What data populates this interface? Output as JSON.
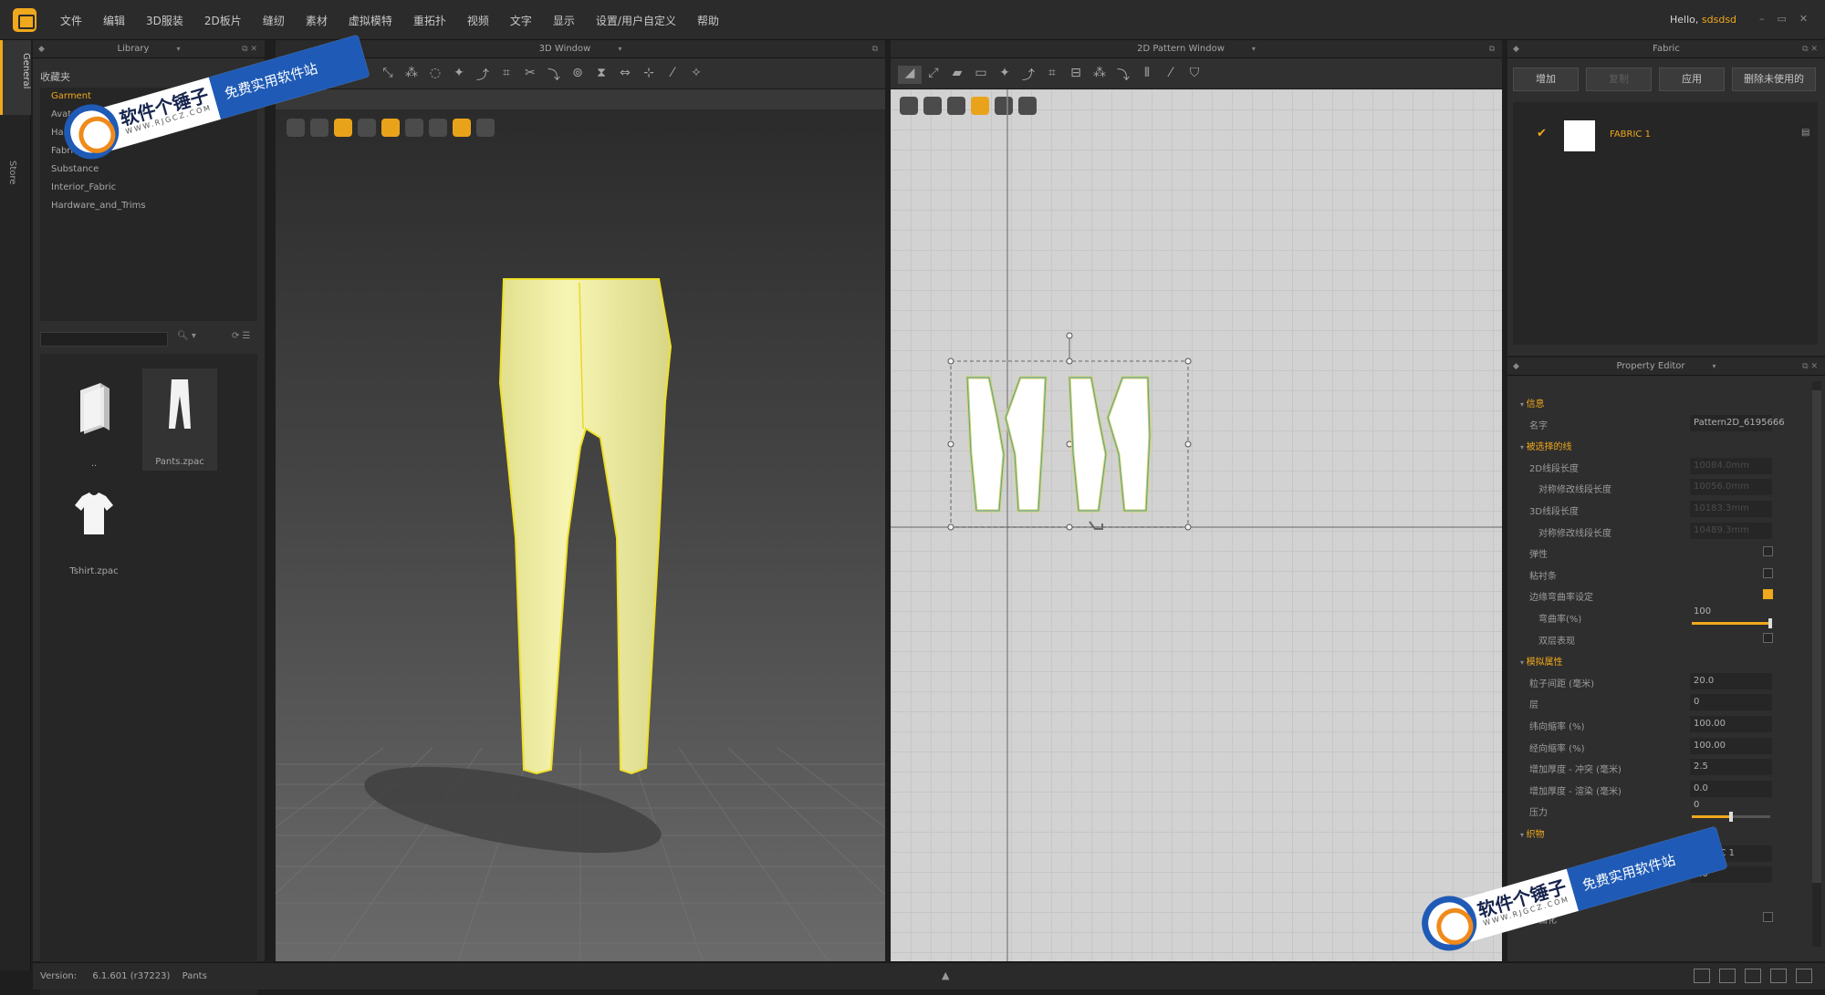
{
  "app": {
    "menu": [
      "文件",
      "编辑",
      "3D服装",
      "2D板片",
      "缝纫",
      "素材",
      "虚拟模特",
      "重拓扑",
      "视频",
      "文字",
      "显示",
      "设置/用户自定义",
      "帮助"
    ],
    "hello_prefix": "Hello,",
    "user": "sdsdsd",
    "window_buttons": [
      "–",
      "▭",
      "✕"
    ]
  },
  "sidetabs": {
    "general": "General",
    "store": "Store"
  },
  "library": {
    "title": "Library",
    "favorites_label": "收藏夹",
    "tree": [
      "Garment",
      "Avatar",
      "Hanger",
      "Fabric",
      "Substance",
      "Interior_Fabric",
      "Hardware_and_Trims"
    ],
    "selected_index": 0,
    "files": [
      {
        "name": "..",
        "icon": "folder-icon"
      },
      {
        "name": "Pants.zpac",
        "icon": "pants-icon"
      },
      {
        "name": "Tshirt.zpac",
        "icon": "tshirt-icon"
      }
    ]
  },
  "window3d": {
    "title": "3D Window"
  },
  "window2d": {
    "title": "2D Pattern Window"
  },
  "fabric": {
    "title": "Fabric",
    "buttons": [
      "增加",
      "复制",
      "应用",
      "删除未使用的"
    ],
    "disabled_button_index": 1,
    "items": [
      {
        "name": "FABRIC 1",
        "color": "#ffffff",
        "checked": true
      }
    ]
  },
  "property_editor": {
    "title": "Property Editor",
    "rows": [
      {
        "label": "信息",
        "type": "section",
        "indent": 0
      },
      {
        "label": "名字",
        "value": "Pattern2D_6195666",
        "indent": 1
      },
      {
        "label": "被选择的线",
        "type": "section",
        "indent": 0
      },
      {
        "label": "2D线段长度",
        "value": "10084.0mm",
        "dim": true,
        "indent": 1
      },
      {
        "label": "对称修改线段长度",
        "value": "10056.0mm",
        "dim": true,
        "indent": 2
      },
      {
        "label": "3D线段长度",
        "value": "10183.3mm",
        "dim": true,
        "indent": 1
      },
      {
        "label": "对称修改线段长度",
        "value": "10489.3mm",
        "dim": true,
        "indent": 2
      },
      {
        "label": "弹性",
        "checkbox": false,
        "indent": 1
      },
      {
        "label": "粘衬条",
        "checkbox": false,
        "indent": 1
      },
      {
        "label": "边缘弯曲率设定",
        "checkbox": true,
        "indent": 1
      },
      {
        "label": "弯曲率(%)",
        "value": "100",
        "slider": 1.0,
        "indent": 2
      },
      {
        "label": "双层表现",
        "checkbox": false,
        "indent": 2
      },
      {
        "label": "模拟属性",
        "type": "section",
        "indent": 0
      },
      {
        "label": "粒子间距 (毫米)",
        "value": "20.0",
        "indent": 1
      },
      {
        "label": "层",
        "value": "0",
        "indent": 1
      },
      {
        "label": "纬向缩率 (%)",
        "value": "100.00",
        "indent": 1
      },
      {
        "label": "经向缩率 (%)",
        "value": "100.00",
        "indent": 1
      },
      {
        "label": "增加厚度 - 冲突 (毫米)",
        "value": "2.5",
        "indent": 1
      },
      {
        "label": "增加厚度 - 渲染 (毫米)",
        "value": "0.0",
        "indent": 1
      },
      {
        "label": "压力",
        "value": "0",
        "slider": 0.5,
        "indent": 1
      },
      {
        "label": "织物",
        "type": "section",
        "indent": 0
      },
      {
        "label": "",
        "value": "FABRIC 1",
        "indent": 1
      },
      {
        "label": "",
        "value": "0.0",
        "indent": 1
      },
      {
        "label": "打开/制造",
        "type": "section",
        "indent": 0
      },
      {
        "label": "形态固化",
        "checkbox": false,
        "indent": 0
      }
    ]
  },
  "status": {
    "version_label": "Version:",
    "version": "6.1.601 (r37223)",
    "file": "Pants"
  },
  "watermark": {
    "brand": "软件个锤子",
    "url": "WWW.RJGCZ.COM",
    "slogan": "免费实用软件站"
  },
  "colors": {
    "accent": "#f0a81c",
    "garment": "#f4f2a6",
    "watermark_blue": "#1f5bb6"
  }
}
